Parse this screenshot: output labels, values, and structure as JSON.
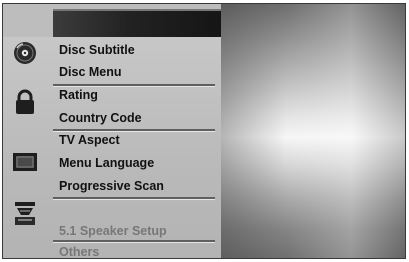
{
  "menu": {
    "items": [
      {
        "label": "Disc Subtitle"
      },
      {
        "label": "Disc Menu"
      },
      {
        "label": "Rating"
      },
      {
        "label": "Country Code"
      },
      {
        "label": "TV Aspect"
      },
      {
        "label": "Menu Language"
      },
      {
        "label": "Progressive Scan"
      },
      {
        "label": "5.1 Speaker Setup"
      },
      {
        "label": "Others"
      }
    ]
  },
  "icons": {
    "disc": "disc-icon",
    "lock": "lock-icon",
    "tv": "tv-icon",
    "speaker": "speaker-icon"
  },
  "colors": {
    "menu_background": "#bdbdbd",
    "text": "#111111",
    "dim_text": "#777777"
  }
}
